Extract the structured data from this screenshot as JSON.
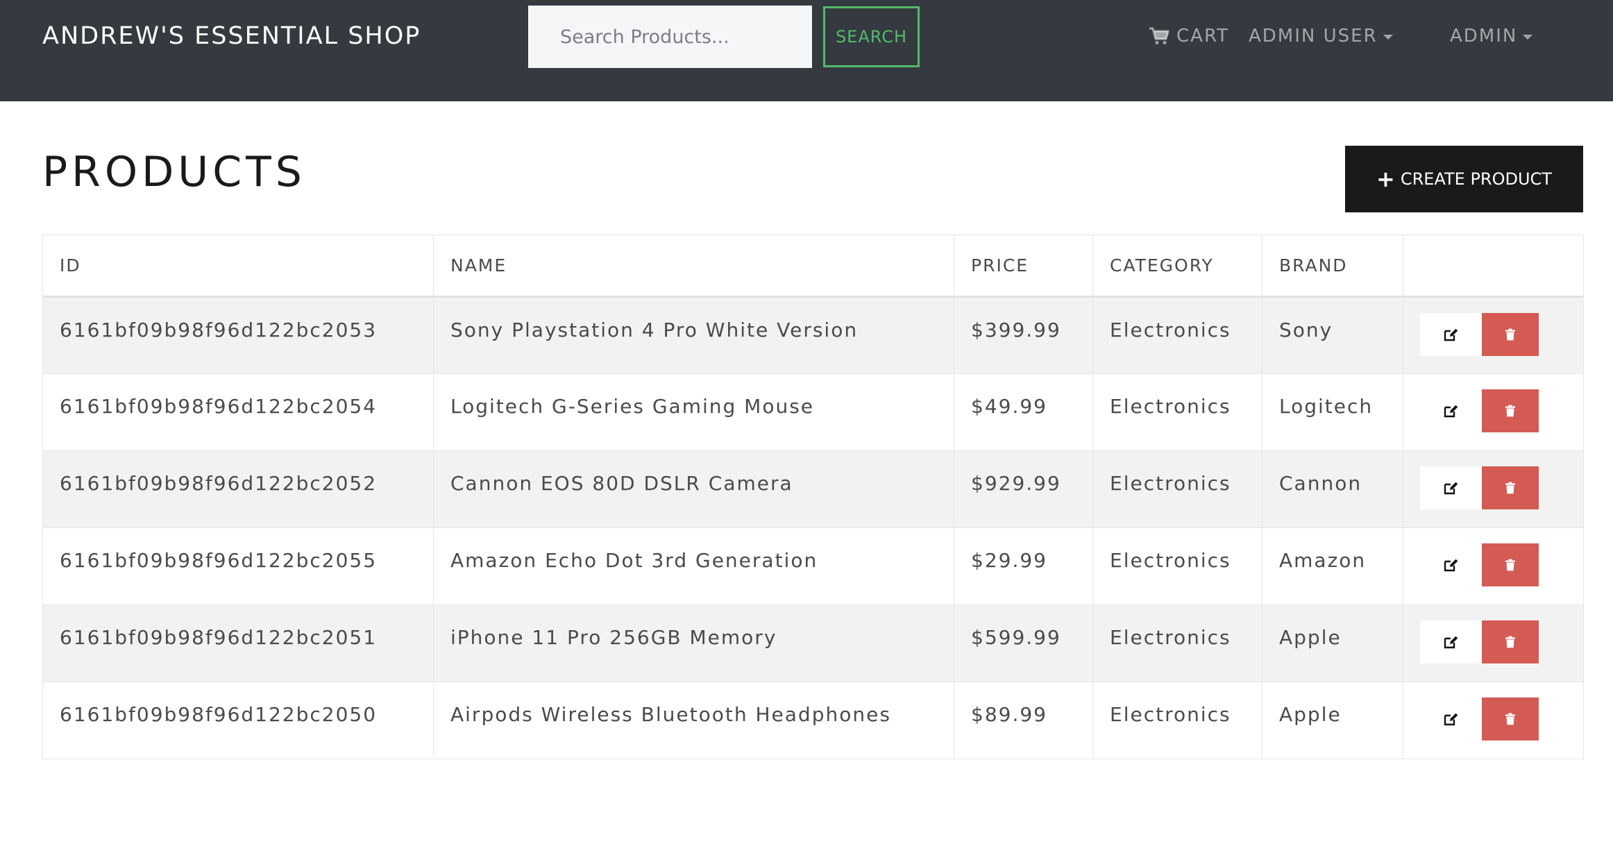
{
  "navbar": {
    "brand": "ANDREW'S ESSENTIAL SHOP",
    "search_placeholder": "Search Products...",
    "search_label": "SEARCH",
    "cart_label": "CART",
    "user_label": "ADMIN USER",
    "admin_label": "ADMIN"
  },
  "page": {
    "title": "PRODUCTS",
    "create_label": "CREATE PRODUCT"
  },
  "table": {
    "headers": [
      "ID",
      "NAME",
      "PRICE",
      "CATEGORY",
      "BRAND",
      ""
    ],
    "rows": [
      {
        "id": "6161bf09b98f96d122bc2053",
        "name": "Sony Playstation 4 Pro White Version",
        "price": "$399.99",
        "category": "Electronics",
        "brand": "Sony"
      },
      {
        "id": "6161bf09b98f96d122bc2054",
        "name": "Logitech G-Series Gaming Mouse",
        "price": "$49.99",
        "category": "Electronics",
        "brand": "Logitech"
      },
      {
        "id": "6161bf09b98f96d122bc2052",
        "name": "Cannon EOS 80D DSLR Camera",
        "price": "$929.99",
        "category": "Electronics",
        "brand": "Cannon"
      },
      {
        "id": "6161bf09b98f96d122bc2055",
        "name": "Amazon Echo Dot 3rd Generation",
        "price": "$29.99",
        "category": "Electronics",
        "brand": "Amazon"
      },
      {
        "id": "6161bf09b98f96d122bc2051",
        "name": "iPhone 11 Pro 256GB Memory",
        "price": "$599.99",
        "category": "Electronics",
        "brand": "Apple"
      },
      {
        "id": "6161bf09b98f96d122bc2050",
        "name": "Airpods Wireless Bluetooth Headphones",
        "price": "$89.99",
        "category": "Electronics",
        "brand": "Apple"
      }
    ]
  },
  "icons": {
    "cart": "shopping-cart-icon",
    "user_caret": "chevron-down-icon",
    "create": "plus-icon",
    "edit": "edit-icon",
    "delete": "trash-icon"
  },
  "colors": {
    "navbar_bg": "#343a40",
    "search_accent": "#55b96a",
    "delete_bg": "#d45a54",
    "create_bg": "#1a1a1a"
  }
}
